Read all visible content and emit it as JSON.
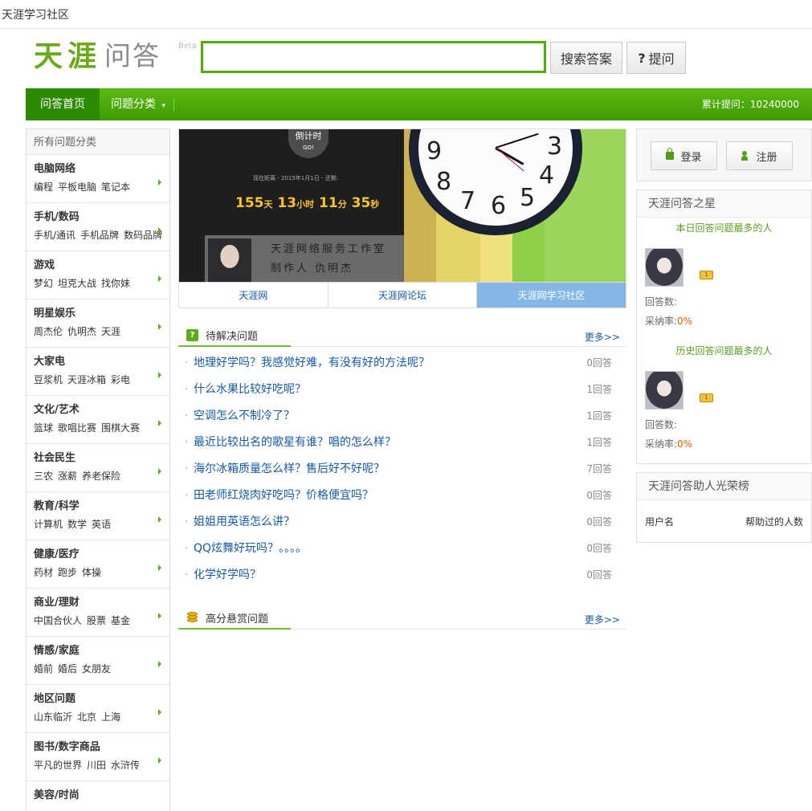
{
  "page": {
    "title": "天涯学习社区"
  },
  "logo": {
    "main": "天涯",
    "sub": "问答",
    "beta": "Beta"
  },
  "search": {
    "value": "",
    "placeholder": "",
    "search_button": "搜索答案",
    "ask_button": "提问",
    "ask_icon": "?"
  },
  "nav": {
    "home": "问答首页",
    "categories": "问题分类",
    "stats_label": "累计提问：",
    "stats_value": "10240000"
  },
  "left": {
    "title": "所有问题分类",
    "categories": [
      {
        "name": "电脑网络",
        "subs": [
          "编程",
          "平板电脑",
          "笔记本"
        ]
      },
      {
        "name": "手机/数码",
        "subs": [
          "手机/通讯",
          "手机品牌",
          "数码品牌"
        ]
      },
      {
        "name": "游戏",
        "subs": [
          "梦幻",
          "坦克大战",
          "找你妹"
        ]
      },
      {
        "name": "明星娱乐",
        "subs": [
          "周杰伦",
          "仇明杰",
          "天涯"
        ]
      },
      {
        "name": "大家电",
        "subs": [
          "豆浆机",
          "天涯冰箱",
          "彩电"
        ]
      },
      {
        "name": "文化/艺术",
        "subs": [
          "篮球",
          "歌唱比赛",
          "围棋大赛"
        ]
      },
      {
        "name": "社会民生",
        "subs": [
          "三农",
          "涨薪",
          "养老保险"
        ]
      },
      {
        "name": "教育/科学",
        "subs": [
          "计算机",
          "数学",
          "英语"
        ]
      },
      {
        "name": "健康/医疗",
        "subs": [
          "药材",
          "跑步",
          "体操"
        ]
      },
      {
        "name": "商业/理财",
        "subs": [
          "中国合伙人",
          "股票",
          "基金"
        ]
      },
      {
        "name": "情感/家庭",
        "subs": [
          "婚前",
          "婚后",
          "女朋友"
        ]
      },
      {
        "name": "地区问题",
        "subs": [
          "山东临沂",
          "北京",
          "上海"
        ]
      },
      {
        "name": "图书/数字商品",
        "subs": [
          "平凡的世界",
          "川田",
          "水浒传"
        ]
      },
      {
        "name": "美容/时尚",
        "subs": []
      }
    ]
  },
  "banner": {
    "countdown_title": "倒计时",
    "countdown_go": "GO!",
    "countdown_note": "现在距离 - 2015年1月1日 - 还剩:",
    "days": "155",
    "days_unit": "天",
    "hours": "13",
    "hours_unit": "小时",
    "minutes": "11",
    "minutes_unit": "分",
    "seconds": "35",
    "seconds_unit": "秒",
    "studio_line1": "天涯网络服务工作室",
    "studio_line2": "制作人  仇明杰",
    "clock_numbers": [
      "9",
      "8",
      "7",
      "6",
      "5",
      "4",
      "3"
    ],
    "stripe_colors": [
      "#ceb252",
      "#e4d465",
      "#efe080",
      "#8fd04a",
      "#9bd65c"
    ]
  },
  "tabs": [
    "天涯网",
    "天涯网论坛",
    "天涯网学习社区"
  ],
  "pending": {
    "title": "待解决问题",
    "more": "更多>>",
    "items": [
      {
        "q": "地理好学吗？我感觉好难，有没有好的方法呢？",
        "count": "0回答"
      },
      {
        "q": "什么水果比较好吃呢？",
        "count": "1回答"
      },
      {
        "q": "空调怎么不制冷了？",
        "count": "1回答"
      },
      {
        "q": "最近比较出名的歌星有谁？唱的怎么样？",
        "count": "1回答"
      },
      {
        "q": "海尔冰箱质量怎么样？售后好不好呢？",
        "count": "7回答"
      },
      {
        "q": "田老师红烧肉好吃吗？价格便宜吗？",
        "count": "0回答"
      },
      {
        "q": "姐姐用英语怎么讲？",
        "count": "0回答"
      },
      {
        "q": "QQ炫舞好玩吗？。。。。",
        "count": "0回答"
      },
      {
        "q": "化学好学吗？",
        "count": "0回答"
      }
    ]
  },
  "reward": {
    "title": "高分悬赏问题",
    "more": "更多>>"
  },
  "right": {
    "login": "登录",
    "register": "注册",
    "star_title": "天涯问答之星",
    "today": {
      "label": "本日回答问题最多的人",
      "badge": "1",
      "answers_label": "回答数:",
      "answers": "",
      "rate_label": "采纳率:",
      "rate": "0%"
    },
    "history": {
      "label": "历史回答问题最多的人",
      "badge": "1",
      "answers_label": "回答数:",
      "answers": "",
      "rate_label": "采纳率:",
      "rate": "0%"
    },
    "rank_title": "天涯问答助人光荣榜",
    "rank_col1": "用户名",
    "rank_col2": "帮助过的人数"
  },
  "colors": {
    "brand_green": "#52ad0a",
    "link_blue": "#135aa8",
    "tab_active": "#84b7e6",
    "rate_orange": "#e05b00"
  }
}
